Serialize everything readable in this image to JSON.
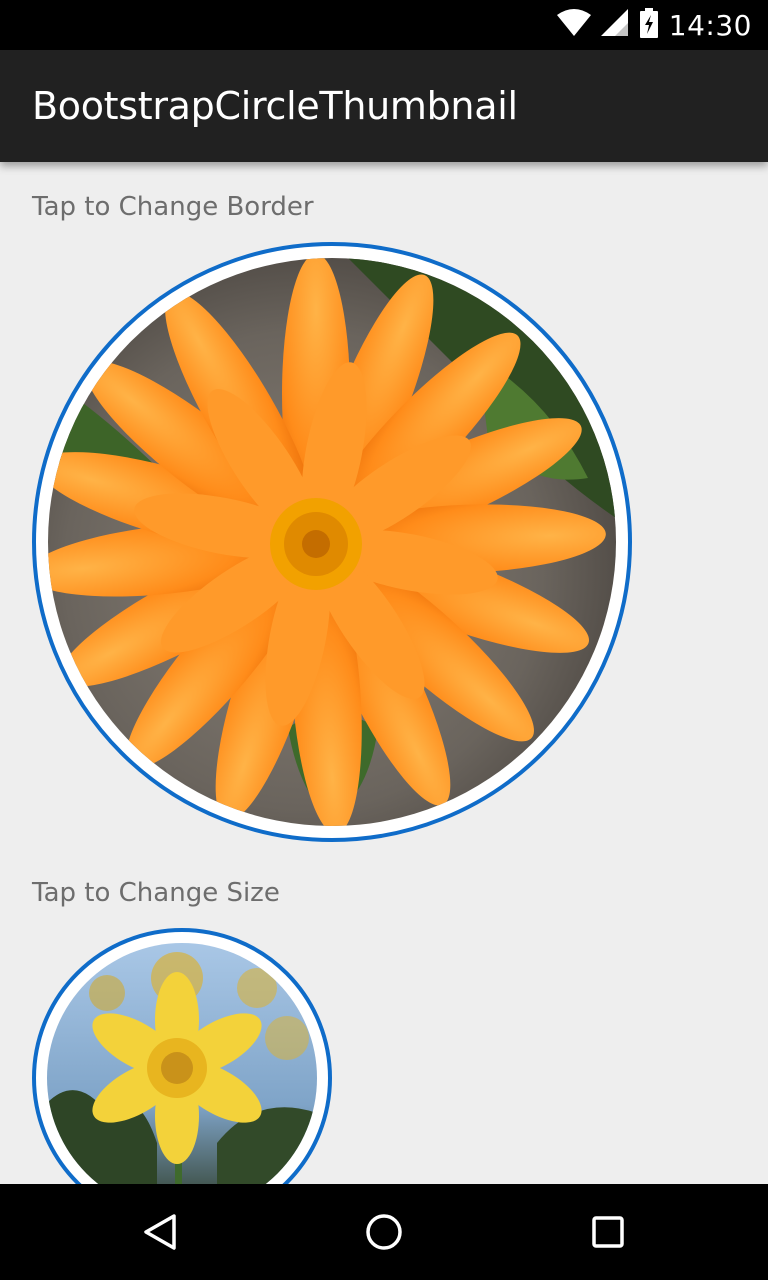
{
  "status_bar": {
    "time": "14:30",
    "icons": [
      "wifi-icon",
      "cell-signal-icon",
      "battery-charging-icon"
    ]
  },
  "app_bar": {
    "title": "BootstrapCircleThumbnail"
  },
  "sections": [
    {
      "label": "Tap to Change Border",
      "image": "orange-flower"
    },
    {
      "label": "Tap to Change Size",
      "image": "yellow-daffodil"
    }
  ],
  "colors": {
    "border_accent": "#0f6cc9",
    "app_bar": "#212121",
    "background": "#eeeeee"
  },
  "nav_bar": {
    "icons": [
      "back-icon",
      "home-icon",
      "recents-icon"
    ]
  }
}
